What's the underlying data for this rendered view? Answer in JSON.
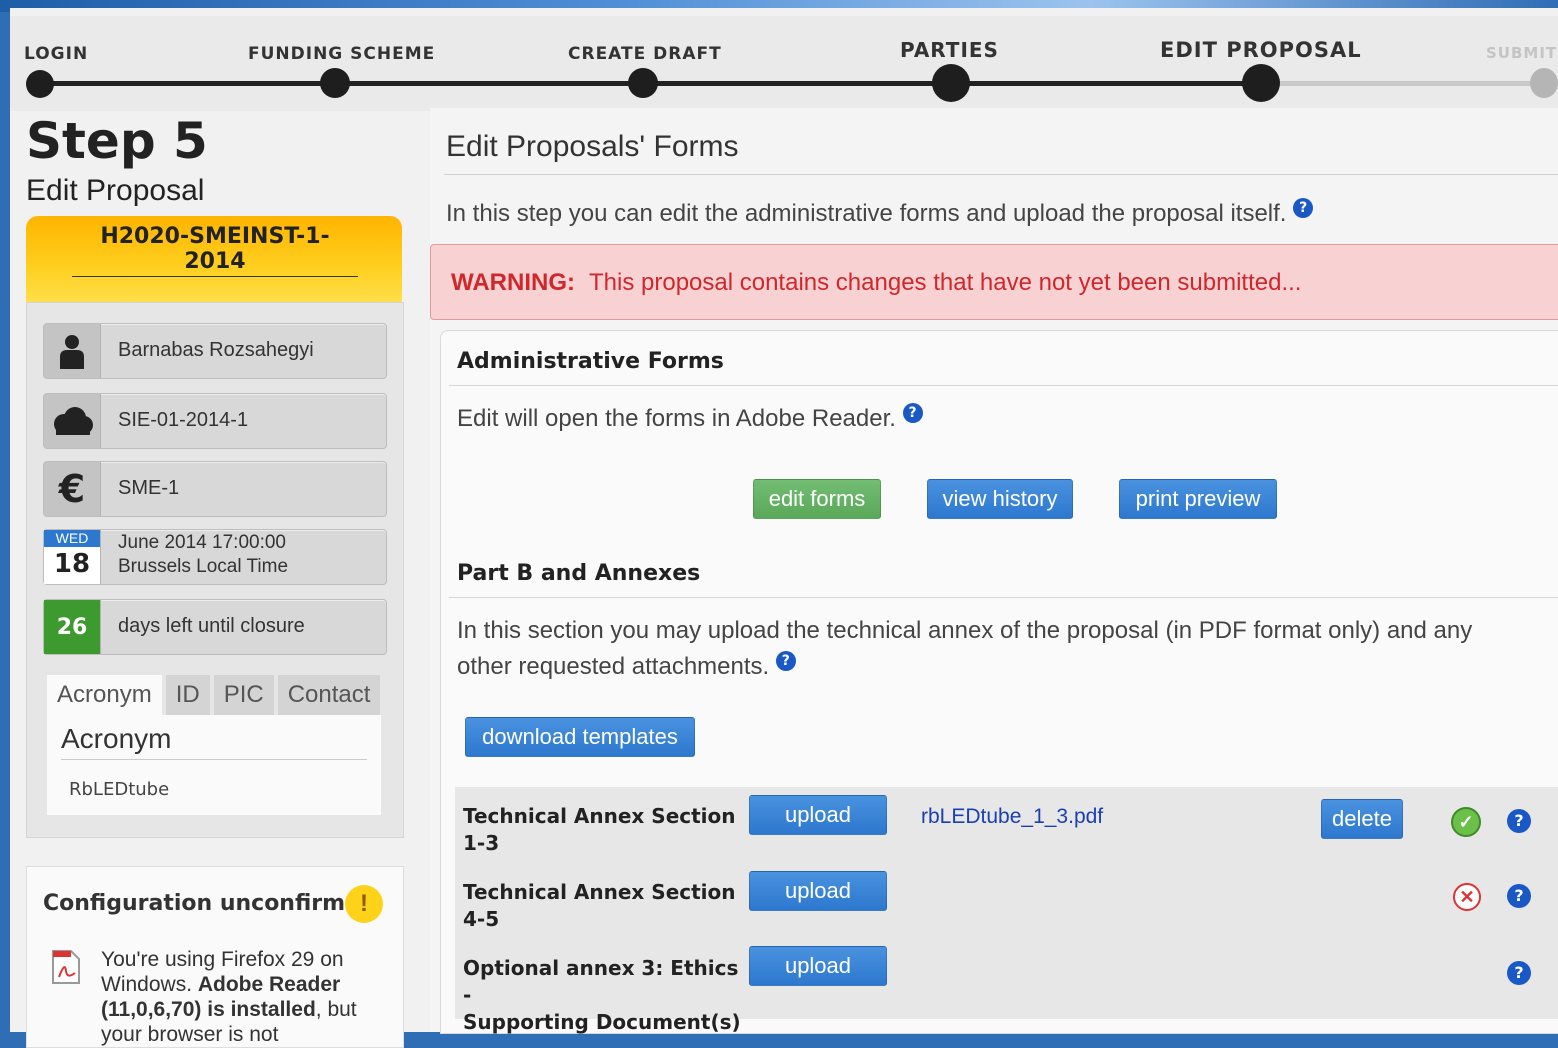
{
  "progress": {
    "steps": [
      {
        "label": "LOGIN"
      },
      {
        "label": "FUNDING SCHEME"
      },
      {
        "label": "CREATE DRAFT"
      },
      {
        "label": "PARTIES"
      },
      {
        "label": "EDIT PROPOSAL"
      },
      {
        "label": "SUBMIT"
      }
    ]
  },
  "sidebar": {
    "step_title": "Step 5",
    "step_subtitle": "Edit Proposal",
    "call_id": "H2020-SMEINST-1-2014",
    "items": [
      {
        "icon": "person-icon",
        "text": "Barnabas Rozsahegyi"
      },
      {
        "icon": "cloud-icon",
        "text": "SIE-01-2014-1"
      },
      {
        "icon": "euro-icon",
        "text": "SME-1"
      },
      {
        "icon": "calendar-icon",
        "day_name": "WED",
        "day_num": "18",
        "line1": "June 2014  17:00:00",
        "line2": "Brussels Local Time"
      },
      {
        "icon": "countdown-icon",
        "count": "26",
        "text": "days left until closure"
      }
    ],
    "tabs": [
      "Acronym",
      "ID",
      "PIC",
      "Contact"
    ],
    "active_tab_heading": "Acronym",
    "acronym_value": "RbLEDtube",
    "config": {
      "heading": "Configuration unconfirmed",
      "warn_glyph": "!",
      "body_1": "You're using Firefox 29 on Windows. ",
      "body_bold": "Adobe Reader (11,0,6,70) is installed",
      "body_2": ", but your browser is not"
    }
  },
  "main": {
    "title": "Edit Proposals' Forms",
    "intro": "In this step you can edit the administrative forms and upload the proposal itself.",
    "warning_label": "WARNING:",
    "warning_text": "This proposal contains changes that have not yet been submitted...",
    "admin": {
      "heading": "Administrative Forms",
      "text": "Edit will open the forms in Adobe Reader.",
      "edit_forms": "edit forms",
      "view_history": "view history",
      "print_preview": "print preview"
    },
    "partb": {
      "heading": "Part B and Annexes",
      "text_line1": "In this section you may upload the technical annex of the proposal (in PDF format only) and any",
      "text_line2": "other requested attachments.",
      "download_templates": "download templates"
    },
    "annexes": [
      {
        "label_line1": "Technical Annex Section",
        "label_line2": "1-3",
        "upload": "upload",
        "file": "rbLEDtube_1_3.pdf",
        "delete": "delete",
        "status": "ok"
      },
      {
        "label_line1": "Technical Annex Section",
        "label_line2": "4-5",
        "upload": "upload",
        "status": "missing"
      },
      {
        "label_line1": "Optional annex 3: Ethics -",
        "label_line2": "Supporting Document(s)",
        "upload": "upload"
      }
    ],
    "help_glyph": "?",
    "ok_glyph": "✓",
    "bad_glyph": "✕"
  },
  "colors": {
    "accent_blue": "#2d78cf",
    "warning_red": "#d0272c",
    "call_orange": "#ffb400"
  }
}
